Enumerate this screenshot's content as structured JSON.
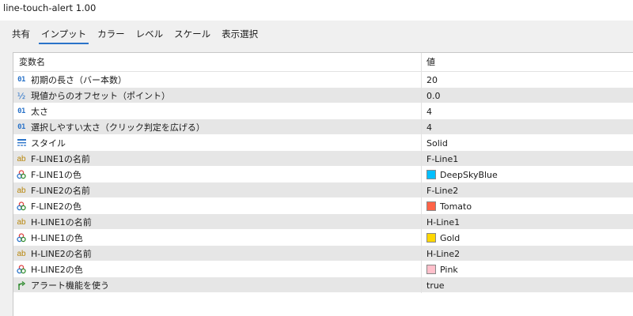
{
  "window": {
    "title": "line-touch-alert 1.00"
  },
  "tabs": [
    {
      "label": "共有",
      "active": false
    },
    {
      "label": "インプット",
      "active": true
    },
    {
      "label": "カラー",
      "active": false
    },
    {
      "label": "レベル",
      "active": false
    },
    {
      "label": "スケール",
      "active": false
    },
    {
      "label": "表示選択",
      "active": false
    }
  ],
  "grid": {
    "header": {
      "name": "変数名",
      "value": "値"
    },
    "rows": [
      {
        "icon": "int-icon",
        "name": "初期の長さ（バー本数）",
        "value": "20"
      },
      {
        "icon": "double-icon",
        "name": "現値からのオフセット（ポイント）",
        "value": "0.0"
      },
      {
        "icon": "int-icon",
        "name": "太さ",
        "value": "4"
      },
      {
        "icon": "int-icon",
        "name": "選択しやすい太さ（クリック判定を広げる）",
        "value": "4"
      },
      {
        "icon": "line-style-icon",
        "name": "スタイル",
        "value": "Solid"
      },
      {
        "icon": "string-icon",
        "name": "F-LINE1の名前",
        "value": "F-Line1"
      },
      {
        "icon": "color-icon",
        "name": "F-LINE1の色",
        "value": "DeepSkyBlue",
        "color": "#00bfff"
      },
      {
        "icon": "string-icon",
        "name": "F-LINE2の名前",
        "value": "F-Line2"
      },
      {
        "icon": "color-icon",
        "name": "F-LINE2の色",
        "value": "Tomato",
        "color": "#ff6347"
      },
      {
        "icon": "string-icon",
        "name": "H-LINE1の名前",
        "value": "H-Line1"
      },
      {
        "icon": "color-icon",
        "name": "H-LINE1の色",
        "value": "Gold",
        "color": "#ffd700"
      },
      {
        "icon": "string-icon",
        "name": "H-LINE2の名前",
        "value": "H-Line2"
      },
      {
        "icon": "color-icon",
        "name": "H-LINE2の色",
        "value": "Pink",
        "color": "#ffc0cb"
      },
      {
        "icon": "bool-icon",
        "name": "アラート機能を使う",
        "value": "true"
      }
    ]
  },
  "colors": {
    "accent": "#2a73c9",
    "row_alt": "#e6e6e6"
  }
}
